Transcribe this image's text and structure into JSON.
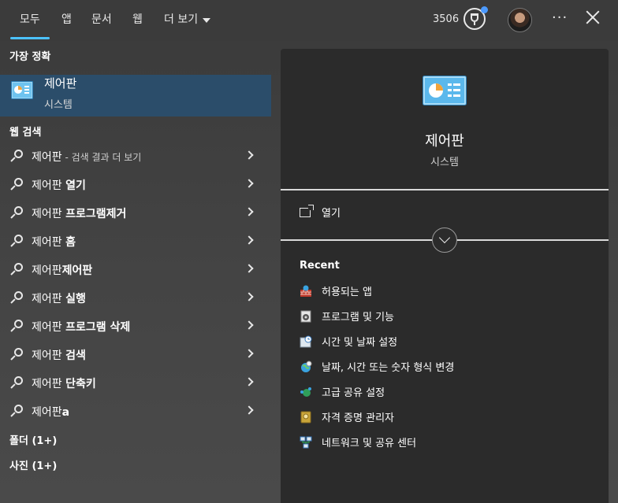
{
  "tabs": [
    {
      "label": "모두",
      "active": true
    },
    {
      "label": "앱"
    },
    {
      "label": "문서"
    },
    {
      "label": "웹"
    },
    {
      "label": "더 보기"
    }
  ],
  "header": {
    "points": "3506",
    "reward_icon": "trophy-icon",
    "more_icon": "ellipsis-icon",
    "close_icon": "close-icon"
  },
  "best_match": {
    "heading": "가장 정확",
    "title": "제어판",
    "subtitle": "시스템",
    "icon": "control-panel-icon"
  },
  "web_search": {
    "heading": "웹 검색",
    "items": [
      {
        "main": "제어판",
        "suffix": " - 검색 결과 더 보기"
      },
      {
        "main": "제어판 ",
        "bold": "열기"
      },
      {
        "main": "제어판 ",
        "bold": "프로그램제거"
      },
      {
        "main": "제어판 ",
        "bold": "홈"
      },
      {
        "main": "제어판",
        "bold": "제어판"
      },
      {
        "main": "제어판 ",
        "bold": "실행"
      },
      {
        "main": "제어판 ",
        "bold": "프로그램 삭제"
      },
      {
        "main": "제어판 ",
        "bold": "검색"
      },
      {
        "main": "제어판 ",
        "bold": "단축키"
      },
      {
        "main": "제어판",
        "bold": "a"
      }
    ]
  },
  "folders": {
    "heading": "폴더 (1+)"
  },
  "photos": {
    "heading": "사진 (1+)"
  },
  "detail": {
    "title": "제어판",
    "subtitle": "시스템",
    "open_label": "열기",
    "recent_heading": "Recent",
    "recent": [
      {
        "label": "허용되는 앱",
        "icon": "firewall-icon"
      },
      {
        "label": "프로그램 및 기능",
        "icon": "programs-icon"
      },
      {
        "label": "시간 및 날짜 설정",
        "icon": "clock-icon"
      },
      {
        "label": "날짜, 시간 또는 숫자 형식 변경",
        "icon": "region-icon"
      },
      {
        "label": "고급 공유 설정",
        "icon": "sharing-icon"
      },
      {
        "label": "자격 증명 관리자",
        "icon": "credential-icon"
      },
      {
        "label": "네트워크 및 공유 센터",
        "icon": "network-icon"
      }
    ]
  },
  "colors": {
    "accent": "#4cc2ff",
    "selection": "#2b4d6a",
    "panel": "#2b2b2b"
  }
}
